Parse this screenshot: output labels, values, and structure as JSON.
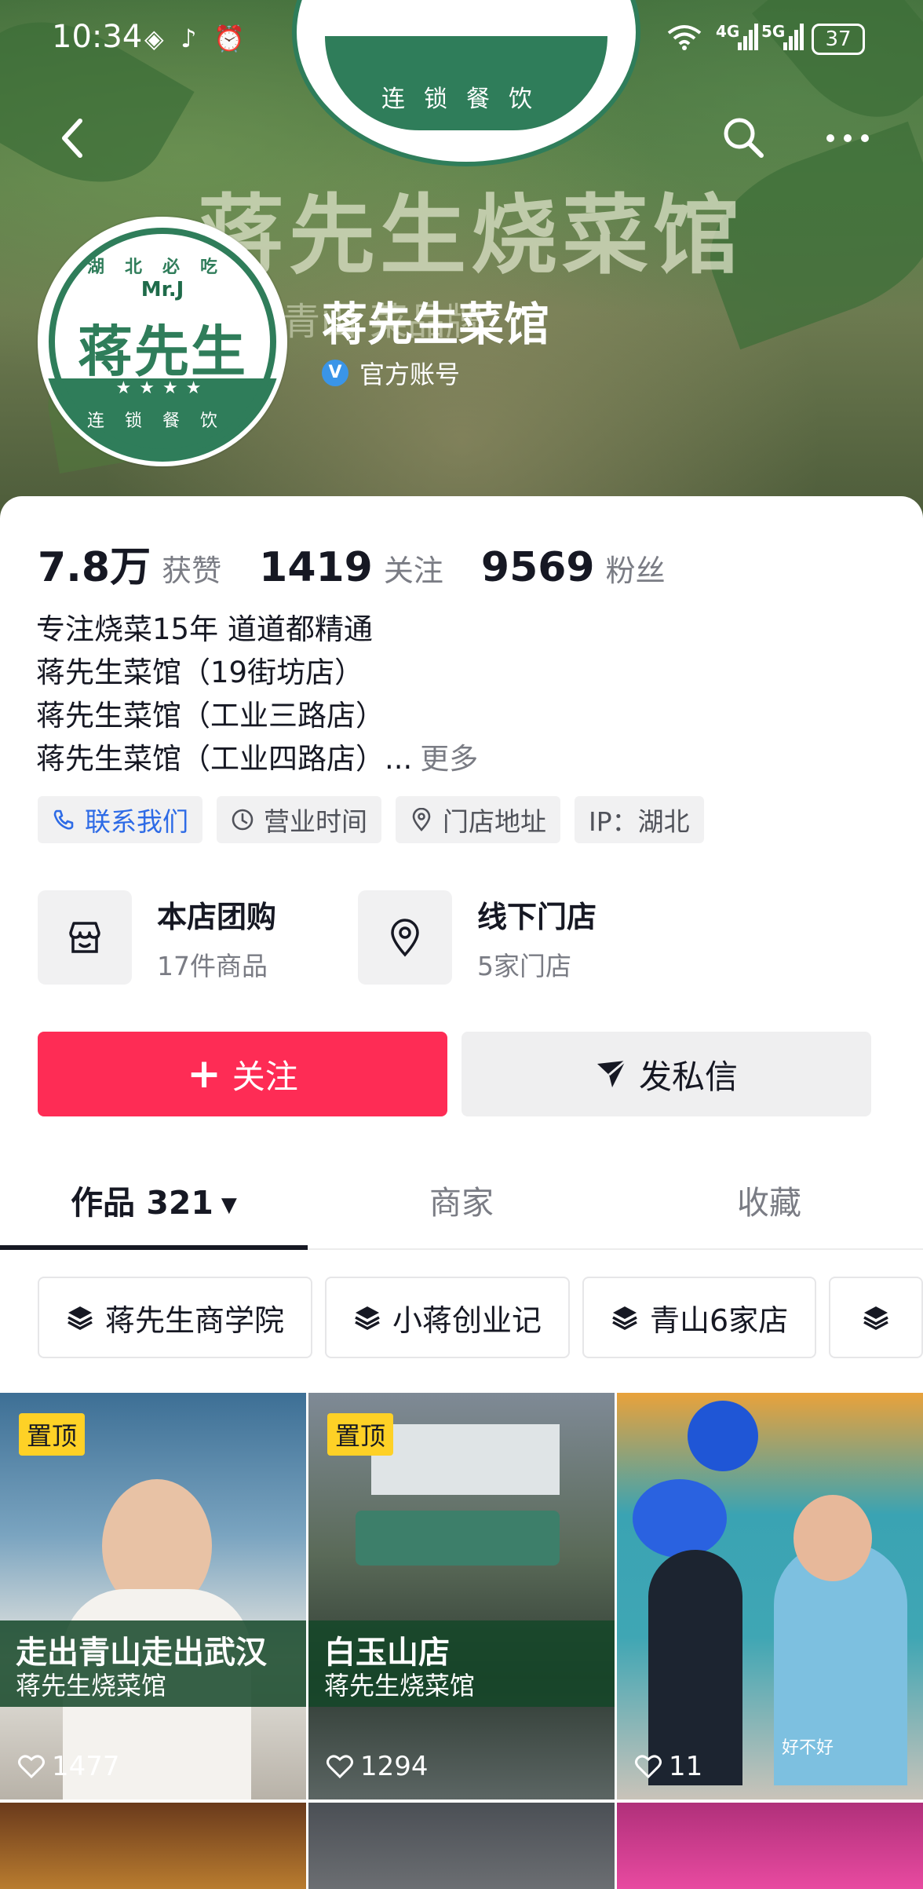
{
  "status_bar": {
    "time": "10:34",
    "net1": "4G",
    "net2": "5G",
    "battery": "37"
  },
  "banner": {
    "title": "蒋先生烧菜馆",
    "subtitle": "青山 菜品牌",
    "logo_text": "连锁餐饮"
  },
  "avatar": {
    "top_text": "湖北必吃",
    "mr": "Mr.J",
    "brand": "蒋先生",
    "bottom_text": "连锁餐饮"
  },
  "profile": {
    "name": "蒋先生菜馆",
    "verified_label": "官方账号"
  },
  "stats": [
    {
      "value": "7.8万",
      "label": "获赞"
    },
    {
      "value": "1419",
      "label": "关注"
    },
    {
      "value": "9569",
      "label": "粉丝"
    }
  ],
  "bio": {
    "lines": [
      "专注烧菜15年 道道都精通",
      "蒋先生菜馆（19街坊店）",
      "蒋先生菜馆（工业三路店）",
      "蒋先生菜馆（工业四路店）..."
    ],
    "more": "更多"
  },
  "chips": [
    {
      "label": "联系我们",
      "icon": "phone-icon"
    },
    {
      "label": "营业时间",
      "icon": "clock-icon"
    },
    {
      "label": "门店地址",
      "icon": "location-icon"
    },
    {
      "label": "IP：湖北"
    }
  ],
  "shortcuts": [
    {
      "title": "本店团购",
      "sub": "17件商品",
      "icon": "shop-icon"
    },
    {
      "title": "线下门店",
      "sub": "5家门店",
      "icon": "location-icon"
    }
  ],
  "buttons": {
    "follow": "关注",
    "message": "发私信"
  },
  "tabs": [
    {
      "label": "作品 321"
    },
    {
      "label": "商家"
    },
    {
      "label": "收藏"
    }
  ],
  "collections": [
    "蒋先生商学院",
    "小蒋创业记",
    "青山6家店"
  ],
  "videos": [
    {
      "pinned": "置顶",
      "title": "走出青山走出武汉",
      "author": "蒋先生烧菜馆",
      "likes": "1477"
    },
    {
      "pinned": "置顶",
      "title": "白玉山店",
      "author": "蒋先生烧菜馆",
      "likes": "1294"
    },
    {
      "likes": "11",
      "overlay": "好不好"
    }
  ],
  "colors": {
    "accent": "#fe2c55",
    "brand_green": "#2f7d5a",
    "pin_yellow": "#fed126"
  }
}
